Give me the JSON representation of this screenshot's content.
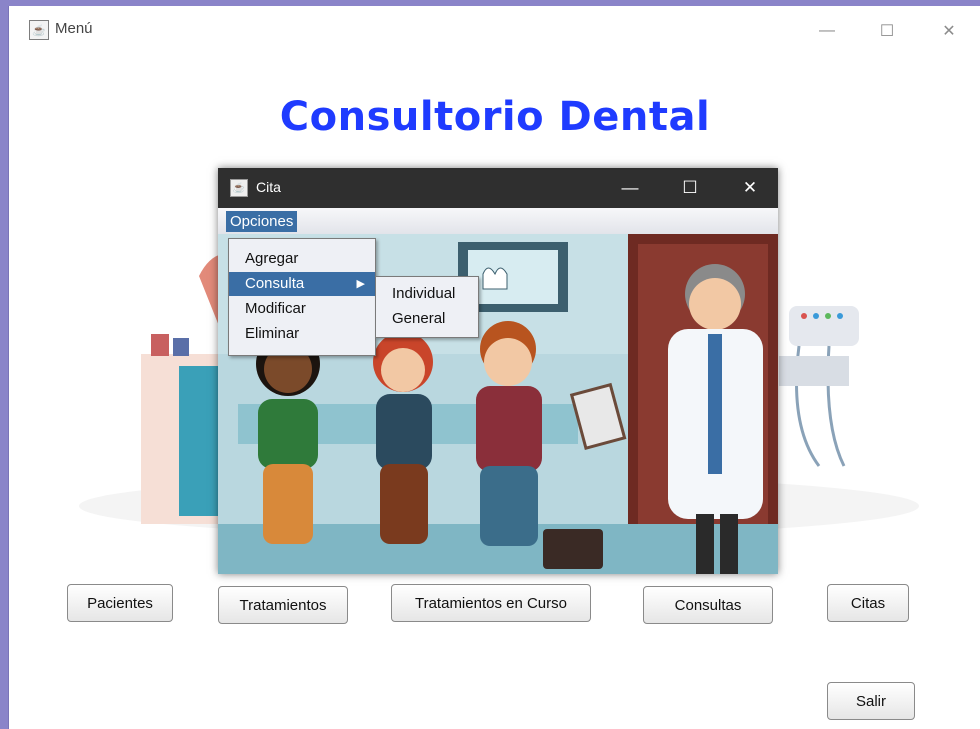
{
  "outer_window": {
    "title": "Menú",
    "icon": "java-cup-icon"
  },
  "window_controls": {
    "minimize": "—",
    "maximize": "☐",
    "close": "✕"
  },
  "main_title": "Consultorio Dental",
  "buttons": {
    "pacientes": "Pacientes",
    "tratamientos": "Tratamientos",
    "tratamientos_curso": "Tratamientos en Curso",
    "consultas": "Consultas",
    "citas": "Citas",
    "salir": "Salir"
  },
  "inner_window": {
    "title": "Cita",
    "icon": "java-cup-icon",
    "menubar": {
      "opciones": "Opciones"
    },
    "dropdown": {
      "items": [
        "Agregar",
        "Consulta",
        "Modificar",
        "Eliminar"
      ],
      "selected": "Consulta",
      "submenu_arrow": "▶"
    },
    "submenu": {
      "items": [
        "Individual",
        "General"
      ]
    }
  },
  "colors": {
    "title": "#1f3bff",
    "menu_highlight": "#3a6ea5",
    "window_border": "#8a84c9"
  }
}
